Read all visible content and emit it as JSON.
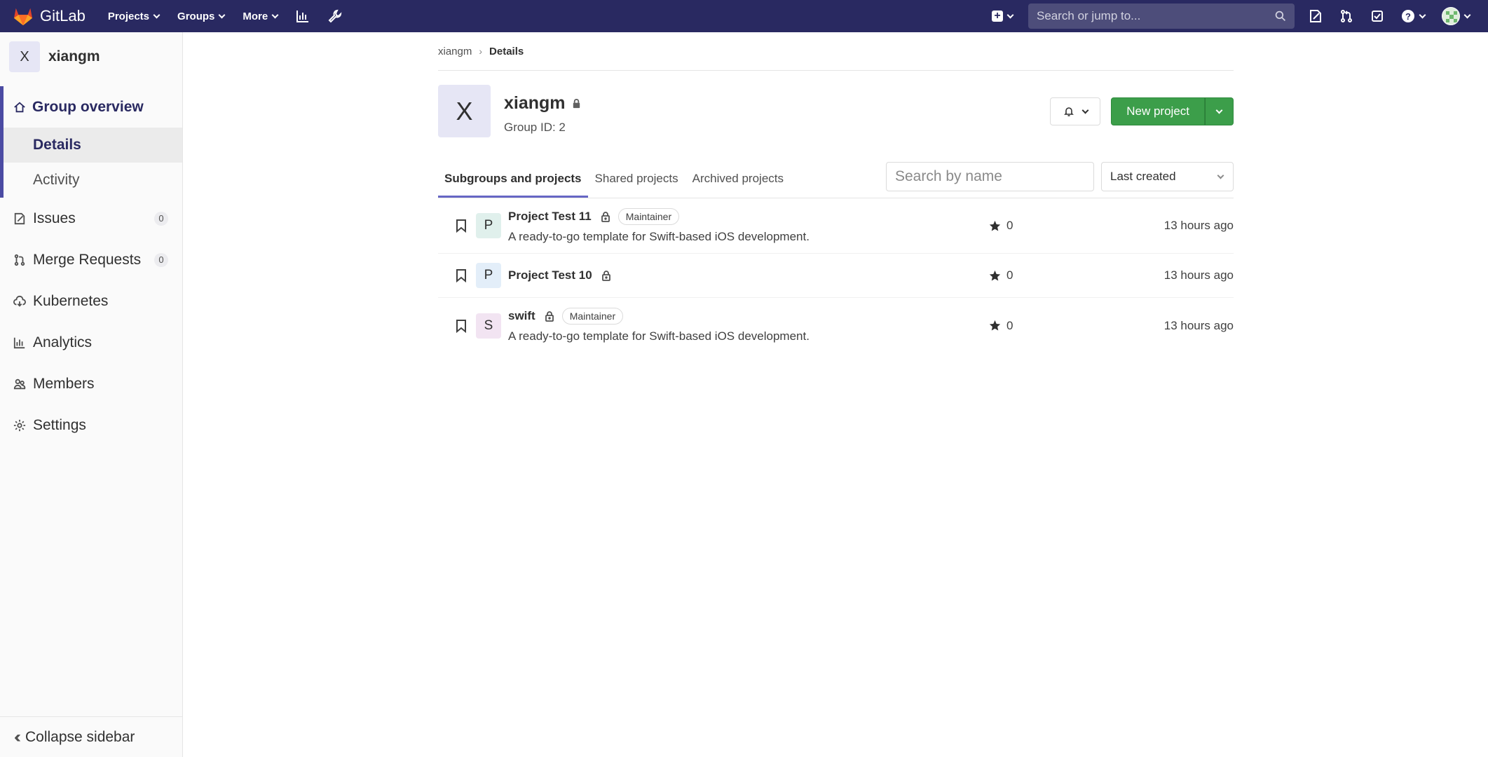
{
  "navbar": {
    "brand": "GitLab",
    "menu": [
      {
        "label": "Projects"
      },
      {
        "label": "Groups"
      },
      {
        "label": "More"
      }
    ],
    "search_placeholder": "Search or jump to...",
    "colors": {
      "background": "#292961"
    }
  },
  "sidebar": {
    "context_avatar": "X",
    "context_title": "xiangm",
    "overview_label": "Group overview",
    "sub_items": [
      {
        "label": "Details",
        "active": true
      },
      {
        "label": "Activity"
      }
    ],
    "items": [
      {
        "label": "Issues",
        "icon": "issues-icon",
        "count": "0"
      },
      {
        "label": "Merge Requests",
        "icon": "merge-request-icon",
        "count": "0"
      },
      {
        "label": "Kubernetes",
        "icon": "cloud-gear-icon"
      },
      {
        "label": "Analytics",
        "icon": "chart-icon"
      },
      {
        "label": "Members",
        "icon": "users-icon"
      },
      {
        "label": "Settings",
        "icon": "settings-icon"
      }
    ],
    "collapse_label": "Collapse sidebar"
  },
  "breadcrumb": {
    "parent": "xiangm",
    "current": "Details"
  },
  "group": {
    "avatar": "X",
    "name": "xiangm",
    "id_text": "Group ID: 2"
  },
  "actions": {
    "new_project_label": "New project"
  },
  "tabs": [
    {
      "label": "Subgroups and projects",
      "active": true
    },
    {
      "label": "Shared projects"
    },
    {
      "label": "Archived projects"
    }
  ],
  "filter": {
    "search_placeholder": "Search by name",
    "sort_selected": "Last created"
  },
  "projects": [
    {
      "avatar": "P",
      "avatar_color": "#e0f0ec",
      "name": "Project Test 11",
      "badge": "Maintainer",
      "description": "A ready-to-go template for Swift-based iOS development.",
      "stars": "0",
      "updated": "13 hours ago"
    },
    {
      "avatar": "P",
      "avatar_color": "#e3eef9",
      "name": "Project Test 10",
      "badge": "",
      "description": "",
      "stars": "0",
      "updated": "13 hours ago"
    },
    {
      "avatar": "S",
      "avatar_color": "#f2e4f2",
      "name": "swift",
      "badge": "Maintainer",
      "description": "A ready-to-go template for Swift-based iOS development.",
      "stars": "0",
      "updated": "13 hours ago"
    }
  ]
}
